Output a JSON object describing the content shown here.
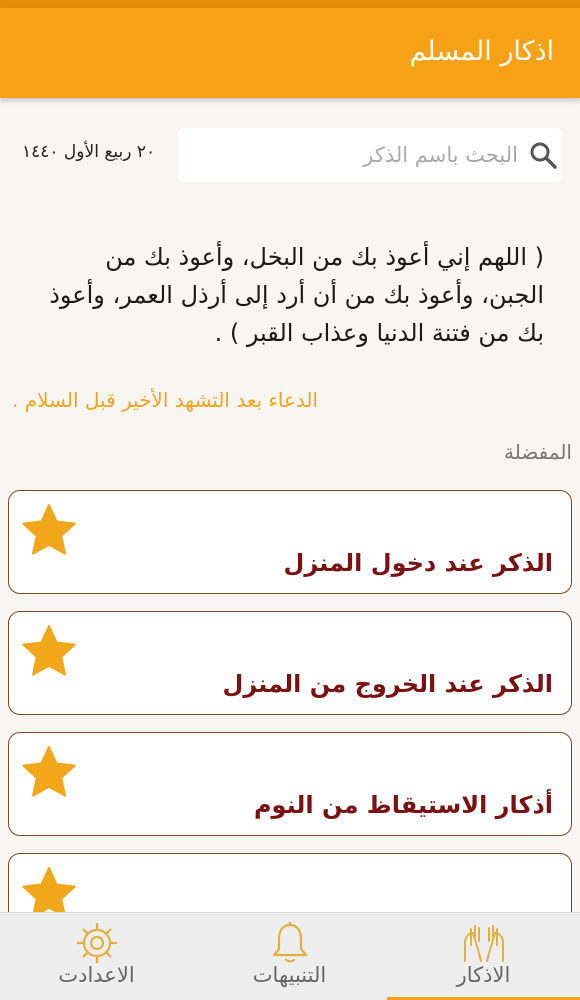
{
  "header": {
    "title": "اذكار المسلم"
  },
  "search": {
    "placeholder": "البحث باسم الذكر",
    "date": "٢٠ ربيع الأول ١٤٤٠"
  },
  "dua": {
    "text": "( اللهم إني أعوذ بك من البخل، وأعوذ بك من الجبن، وأعوذ بك من أن أرد إلى أرذل العمر، وأعوذ بك من فتنة الدنيا وعذاب القبر ) .",
    "caption": "الدعاء بعد التشهد الأخير قبل السلام ..."
  },
  "favorites": {
    "heading": "المفضلة",
    "items": [
      {
        "label": "الذكر عند دخول المنزل"
      },
      {
        "label": "الذكر عند الخروج من المنزل"
      },
      {
        "label": "أذكار الاستيقاظ من النوم"
      },
      {
        "label": ""
      }
    ]
  },
  "nav": {
    "tabs": [
      {
        "label": "الاعدادت",
        "icon": "gear-icon"
      },
      {
        "label": "التنبيهات",
        "icon": "bell-icon"
      },
      {
        "label": "الاذكار",
        "icon": "praying-hands-icon"
      }
    ],
    "active": "الاذكار"
  },
  "colors": {
    "accent": "#f7a216",
    "star": "#f2a71b",
    "card_border": "#7a4b1e",
    "card_text": "#7a1212",
    "caption": "#f0a31d"
  }
}
